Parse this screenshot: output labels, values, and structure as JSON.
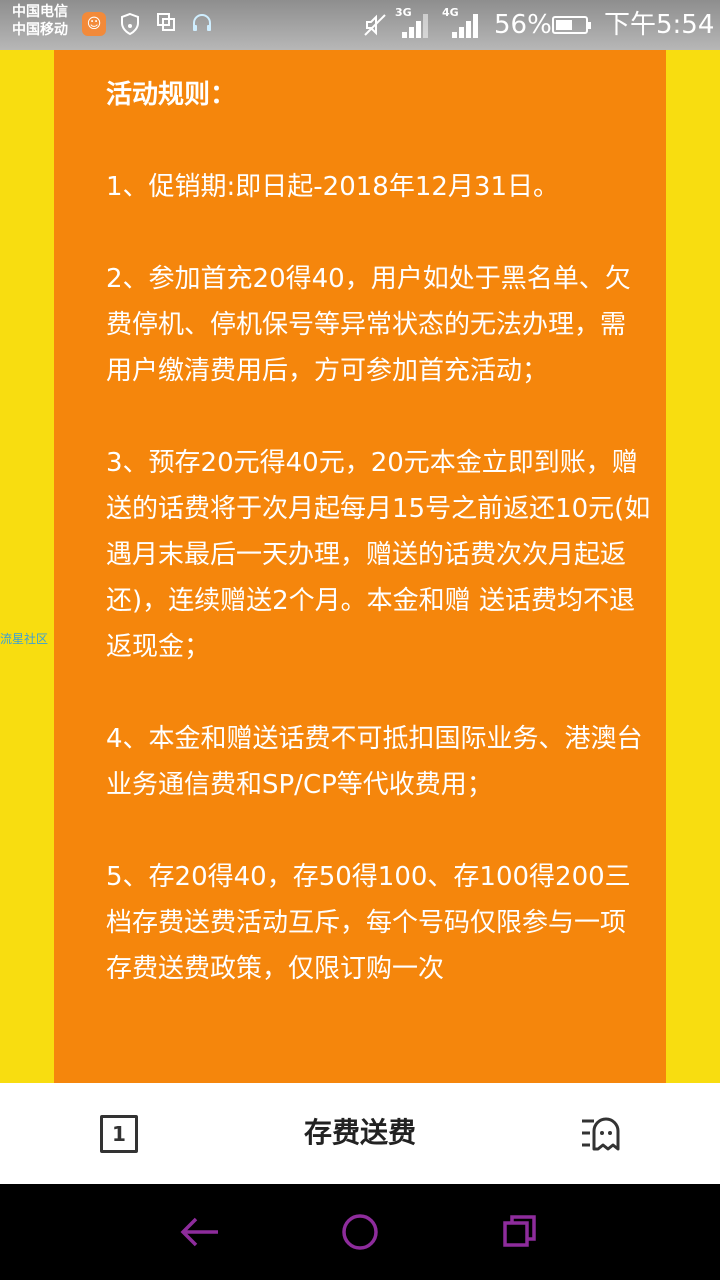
{
  "status_bar": {
    "carrier_1": "中国电信",
    "carrier_2": "中国移动",
    "network_1": "3G",
    "network_2": "4G",
    "battery_percent": "56%",
    "battery_level": 0.56,
    "time": "下午5:54"
  },
  "content": {
    "watermark": "流星社区",
    "heading": "活动规则：",
    "rules": [
      "1、促销期:即日起-2018年12月31日。",
      "2、参加首充20得40，用户如处于黑名单、欠费停机、停机保号等异常状态的无法办理，需用户缴清费用后，方可参加首充活动；",
      "3、预存20元得40元，20元本金立即到账，赠送的话费将于次月起每月15号之前返还10元(如遇月末最后一天办理，赠送的话费次次月起返还)，连续赠送2个月。本金和赠 送话费均不退返现金；",
      "4、本金和赠送话费不可抵扣国际业务、港澳台业务通信费和SP/CP等代收费用；",
      "5、存20得40，存50得100、存100得200三档存费送费活动互斥，每个号码仅限参与一项存费送费政策，仅限订购一次"
    ]
  },
  "toolbar": {
    "tab_count": "1",
    "title": "存费送费"
  },
  "icons": {
    "app": "app-notification-icon",
    "wifi": "wifi-shield-icon",
    "copy": "copy-icon",
    "headset": "headset-icon",
    "mute": "mute-icon",
    "menu": "menu-chat-icon",
    "back": "back-arrow-icon",
    "home": "home-circle-icon",
    "recent": "recent-apps-icon"
  },
  "colors": {
    "background_yellow": "#f8dd10",
    "panel_orange": "#f5860c",
    "nav_accent": "#8e2c9c"
  }
}
